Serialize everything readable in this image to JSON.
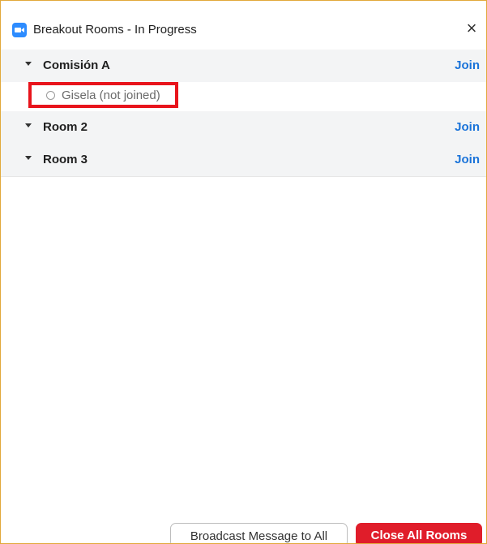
{
  "window": {
    "title": "Breakout Rooms - In Progress",
    "app_icon": "zoom-camera-icon",
    "close_glyph": "×",
    "accent_border": "#e2a93b"
  },
  "rooms": [
    {
      "name": "Comisión A",
      "join_label": "Join",
      "expanded": true,
      "participants": [
        {
          "name": "Gisela (not joined)",
          "status_icon": "not-joined-circle-icon"
        }
      ]
    },
    {
      "name": "Room 2",
      "join_label": "Join",
      "expanded": true,
      "participants": []
    },
    {
      "name": "Room 3",
      "join_label": "Join",
      "expanded": true,
      "participants": []
    }
  ],
  "footer": {
    "broadcast_label": "Broadcast Message to All",
    "close_all_label": "Close All Rooms"
  },
  "colors": {
    "join_link": "#1a73d9",
    "close_all_bg": "#e01d2a",
    "highlight": "#e8141c",
    "room_header_bg": "#f3f4f5"
  }
}
